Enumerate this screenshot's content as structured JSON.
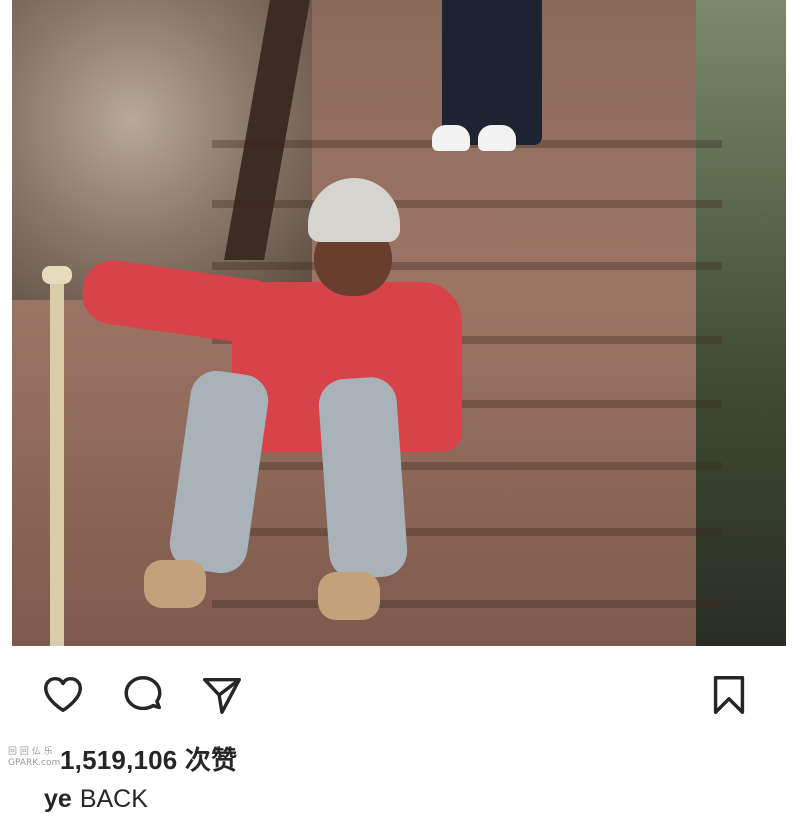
{
  "post": {
    "photo_alt": "photo"
  },
  "actions": {
    "like_icon": "heart-icon",
    "comment_icon": "comment-icon",
    "share_icon": "paper-plane-icon",
    "save_icon": "bookmark-icon"
  },
  "likes": {
    "watermark_line1": "回 回 仏 乐",
    "watermark_line2": "GPARK.com",
    "count_text": "1,519,106 次赞"
  },
  "caption": {
    "username": "ye",
    "text": "BACK"
  },
  "colors": {
    "text": "#262626",
    "background": "#ffffff"
  }
}
